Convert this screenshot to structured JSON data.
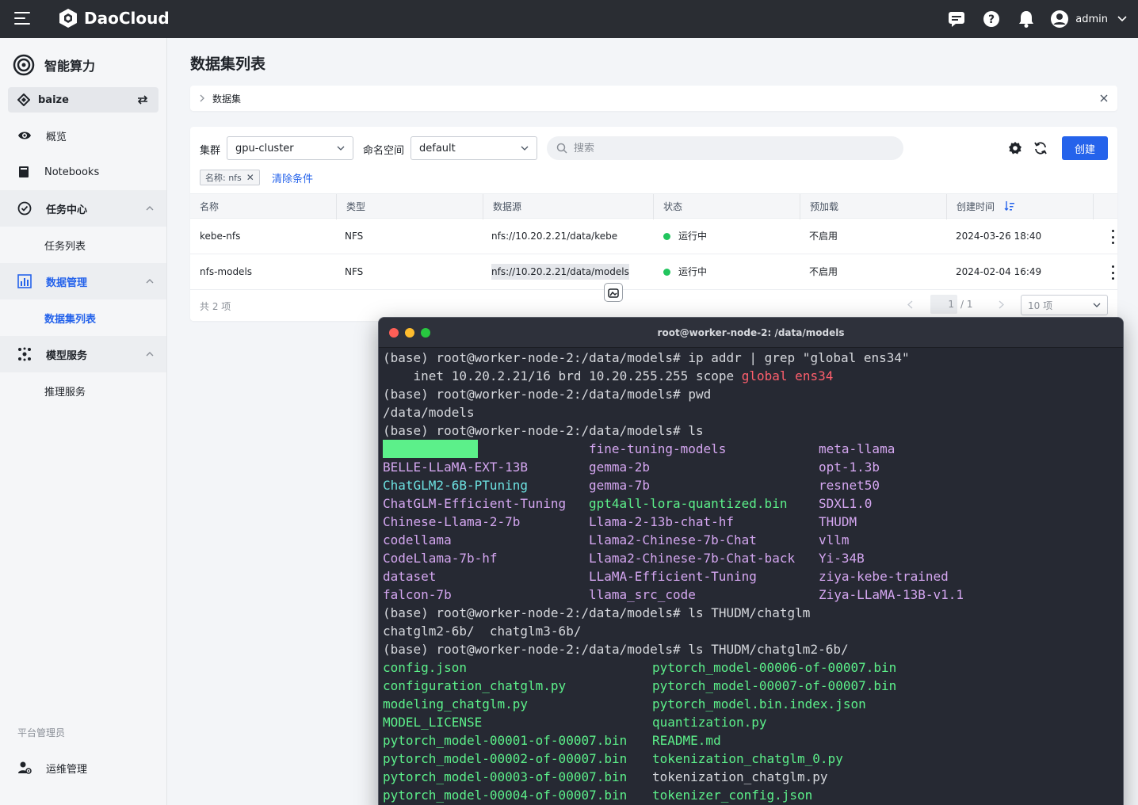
{
  "topbar": {
    "brand": "DaoCloud",
    "user": "admin",
    "icons": [
      "menu-icon",
      "message-icon",
      "help-icon",
      "bell-icon",
      "user-avatar-icon",
      "chevron-down-icon"
    ]
  },
  "sidebar": {
    "app_title": "智能算力",
    "workspace": "baize",
    "items": [
      {
        "label": "概览",
        "icon": "eye-icon"
      },
      {
        "label": "Notebooks",
        "icon": "notebook-icon"
      },
      {
        "label": "任务中心",
        "icon": "task-icon"
      },
      {
        "label": "任务列表"
      },
      {
        "label": "数据管理",
        "icon": "chart-icon"
      },
      {
        "label": "数据集列表"
      },
      {
        "label": "模型服务",
        "icon": "model-icon"
      },
      {
        "label": "推理服务"
      }
    ],
    "section_label": "平台管理员",
    "ops": "运维管理"
  },
  "main": {
    "title": "数据集列表",
    "breadcrumb": "数据集",
    "filters": {
      "cluster_label": "集群",
      "cluster_value": "gpu-cluster",
      "namespace_label": "命名空间",
      "namespace_value": "default",
      "search_placeholder": "搜索"
    },
    "create_label": "创建",
    "chip": "名称: nfs",
    "clear_label": "清除条件",
    "columns": [
      "名称",
      "类型",
      "数据源",
      "状态",
      "预加载",
      "创建时间"
    ],
    "rows": [
      {
        "name": "kebe-nfs",
        "type": "NFS",
        "source": "nfs://10.20.2.21/data/kebe",
        "status": "运行中",
        "preload": "不启用",
        "created": "2024-03-26 18:40"
      },
      {
        "name": "nfs-models",
        "type": "NFS",
        "source": "nfs://10.20.2.21/data/models",
        "status": "运行中",
        "preload": "不启用",
        "created": "2024-02-04 16:49"
      }
    ],
    "total": "共 2 项",
    "page_current": "1",
    "page_total": "/ 1",
    "page_size": "10 项"
  },
  "terminal": {
    "title": "root@worker-node-2: /data/models",
    "lines": [
      "(base) root@worker-node-2:/data/models# ip addr | grep \"global ens34\"",
      "    inet 10.20.2.21/16 brd 10.20.255.255 scope ",
      "(base) root@worker-node-2:/data/models# pwd",
      "/data/models",
      "(base) root@worker-node-2:/data/models# ls"
    ],
    "highlight_word": "global ens34",
    "ls1": {
      "col1": [
        "",
        "BELLE-LLaMA-EXT-13B",
        "ChatGLM2-6B-PTuning",
        "ChatGLM-Efficient-Tuning",
        "Chinese-Llama-2-7b",
        "codellama",
        "CodeLlama-7b-hf",
        "dataset",
        "falcon-7b"
      ],
      "col2": [
        "fine-tuning-models",
        "gemma-2b",
        "gemma-7b",
        "gpt4all-lora-quantized.bin",
        "Llama-2-13b-chat-hf",
        "Llama2-Chinese-7b-Chat",
        "Llama2-Chinese-7b-Chat-back",
        "LLaMA-Efficient-Tuning",
        "llama_src_code"
      ],
      "col3": [
        "meta-llama",
        "opt-1.3b",
        "resnet50",
        "SDXL1.0",
        "THUDM",
        "vllm",
        "Yi-34B",
        "ziya-kebe-trained",
        "Ziya-LLaMA-13B-v1.1"
      ]
    },
    "lines2": [
      "(base) root@worker-node-2:/data/models# ls THUDM/chatglm",
      "chatglm2-6b/  chatglm3-6b/",
      "(base) root@worker-node-2:/data/models# ls THUDM/chatglm2-6b/"
    ],
    "ls2": {
      "col1": [
        "config.json",
        "configuration_chatglm.py",
        "modeling_chatglm.py",
        "MODEL_LICENSE",
        "pytorch_model-00001-of-00007.bin",
        "pytorch_model-00002-of-00007.bin",
        "pytorch_model-00003-of-00007.bin",
        "pytorch_model-00004-of-00007.bin"
      ],
      "col2": [
        "pytorch_model-00006-of-00007.bin",
        "pytorch_model-00007-of-00007.bin",
        "pytorch_model.bin.index.json",
        "quantization.py",
        "README.md",
        "tokenization_chatglm_0.py",
        "tokenization_chatglm.py",
        "tokenizer_config.json"
      ]
    }
  },
  "colors": {
    "topbar": "#2a2d33",
    "accent": "#2563eb",
    "status_running": "#22c55e",
    "terminal_bg": "#262933",
    "term_green": "#5cf08a",
    "term_purple": "#d4a6f0",
    "term_red": "#ff5f6d",
    "term_cyan": "#6ce0e0"
  }
}
